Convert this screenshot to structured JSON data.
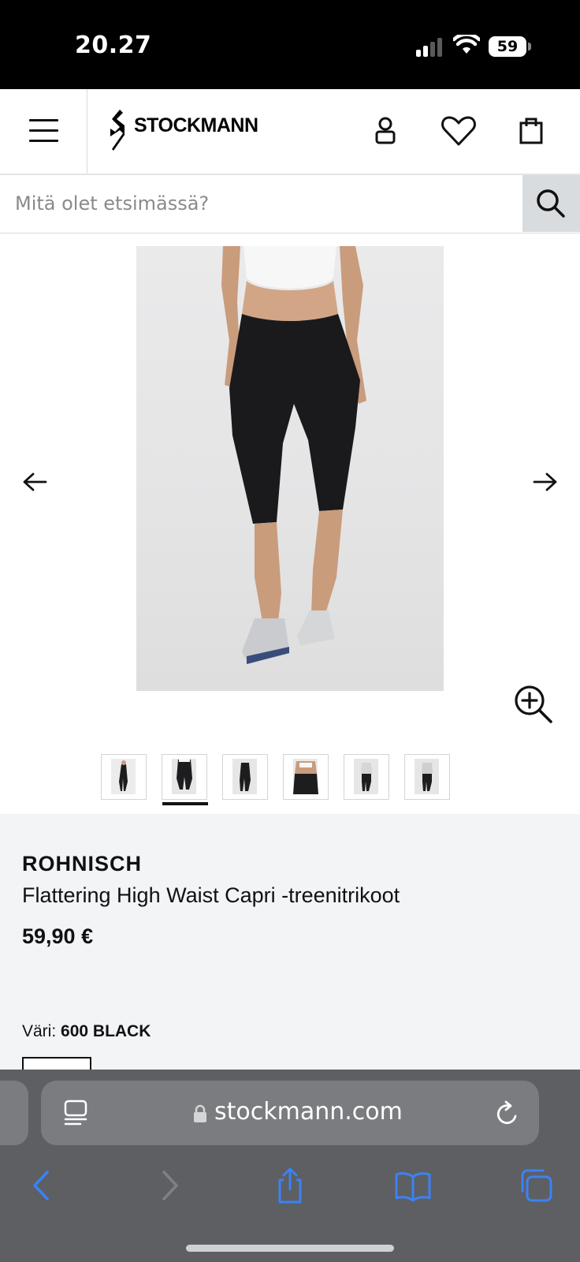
{
  "status_bar": {
    "time": "20.27",
    "battery": "59"
  },
  "header": {
    "logo_text": "STOCKMANN",
    "menu_icon": "hamburger-icon",
    "account_icon": "user-icon",
    "wishlist_icon": "heart-icon",
    "cart_icon": "shopping-bag-icon"
  },
  "search": {
    "placeholder": "Mitä olet etsimässä?",
    "icon": "search-icon"
  },
  "gallery": {
    "prev_icon": "arrow-left-icon",
    "next_icon": "arrow-right-icon",
    "zoom_icon": "zoom-in-icon",
    "thumbnail_count": 6,
    "active_thumbnail": 2
  },
  "product": {
    "brand": "ROHNISCH",
    "name": "Flattering High Waist Capri -treenitrikoot",
    "price": "59,90 €",
    "color_label": "Väri:",
    "color_value": "600 BLACK"
  },
  "browser": {
    "url": "stockmann.com",
    "reader_icon": "reader-mode-icon",
    "lock_icon": "lock-icon",
    "reload_icon": "reload-icon",
    "toolbar": [
      "back-icon",
      "forward-icon",
      "share-icon",
      "bookmarks-icon",
      "tabs-icon"
    ],
    "accent_color": "#3b82f6"
  }
}
